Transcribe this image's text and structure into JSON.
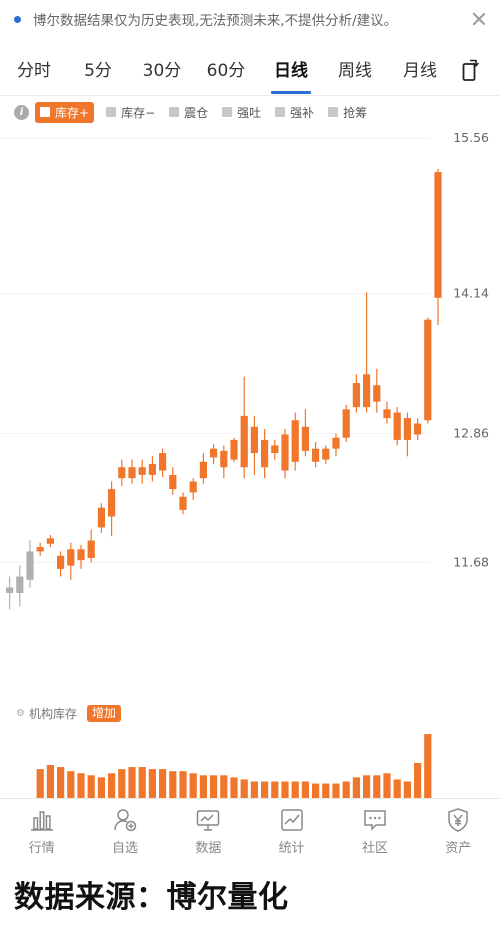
{
  "notice": {
    "text": "博尔数据结果仅为历史表现,无法预测未来,不提供分析/建议。"
  },
  "tabs": [
    "分时",
    "5分",
    "30分",
    "60分",
    "日线",
    "周线",
    "月线"
  ],
  "active_tab": "日线",
  "legend": {
    "items": [
      "库存+",
      "库存−",
      "震仓",
      "强吐",
      "强补",
      "抢筹"
    ],
    "active": "库存+"
  },
  "volume_panel": {
    "label": "机构库存",
    "badge": "增加"
  },
  "bottom_nav": [
    {
      "label": "行情",
      "icon": "bar-chart-icon"
    },
    {
      "label": "自选",
      "icon": "user-add-icon"
    },
    {
      "label": "数据",
      "icon": "monitor-chart-icon"
    },
    {
      "label": "统计",
      "icon": "line-chart-icon"
    },
    {
      "label": "社区",
      "icon": "chat-bubble-icon"
    },
    {
      "label": "资产",
      "icon": "yen-shield-icon"
    }
  ],
  "caption": "数据来源：博尔量化",
  "colors": {
    "up": "#f0762b",
    "down": "#b0b0b0",
    "accent": "#2a6fd6",
    "grid": "#f2f2f2"
  },
  "chart_data": {
    "type": "candlestick",
    "y_ticks": [
      "15.56",
      "14.14",
      "12.86",
      "11.68"
    ],
    "ylim": [
      11.0,
      15.6
    ],
    "candles": [
      {
        "o": 11.4,
        "c": 11.45,
        "h": 11.55,
        "l": 11.25,
        "color": "down"
      },
      {
        "o": 11.4,
        "c": 11.55,
        "h": 11.65,
        "l": 11.28,
        "color": "down"
      },
      {
        "o": 11.52,
        "c": 11.78,
        "h": 11.88,
        "l": 11.45,
        "color": "down"
      },
      {
        "o": 11.78,
        "c": 11.82,
        "h": 11.86,
        "l": 11.74,
        "color": "up"
      },
      {
        "o": 11.85,
        "c": 11.9,
        "h": 11.93,
        "l": 11.82,
        "color": "up"
      },
      {
        "o": 11.62,
        "c": 11.74,
        "h": 11.78,
        "l": 11.55,
        "color": "up"
      },
      {
        "o": 11.65,
        "c": 11.8,
        "h": 11.86,
        "l": 11.52,
        "color": "up"
      },
      {
        "o": 11.7,
        "c": 11.8,
        "h": 11.84,
        "l": 11.62,
        "color": "up"
      },
      {
        "o": 11.72,
        "c": 11.88,
        "h": 11.98,
        "l": 11.68,
        "color": "up"
      },
      {
        "o": 12.0,
        "c": 12.18,
        "h": 12.22,
        "l": 11.95,
        "color": "up"
      },
      {
        "o": 12.1,
        "c": 12.35,
        "h": 12.42,
        "l": 11.92,
        "color": "up"
      },
      {
        "o": 12.45,
        "c": 12.55,
        "h": 12.62,
        "l": 12.38,
        "color": "up"
      },
      {
        "o": 12.45,
        "c": 12.55,
        "h": 12.62,
        "l": 12.4,
        "color": "up"
      },
      {
        "o": 12.48,
        "c": 12.55,
        "h": 12.62,
        "l": 12.4,
        "color": "up"
      },
      {
        "o": 12.48,
        "c": 12.58,
        "h": 12.65,
        "l": 12.42,
        "color": "up"
      },
      {
        "o": 12.52,
        "c": 12.68,
        "h": 12.72,
        "l": 12.46,
        "color": "up"
      },
      {
        "o": 12.35,
        "c": 12.48,
        "h": 12.55,
        "l": 12.3,
        "color": "up"
      },
      {
        "o": 12.16,
        "c": 12.28,
        "h": 12.32,
        "l": 12.12,
        "color": "up"
      },
      {
        "o": 12.32,
        "c": 12.42,
        "h": 12.45,
        "l": 12.25,
        "color": "up"
      },
      {
        "o": 12.45,
        "c": 12.6,
        "h": 12.68,
        "l": 12.4,
        "color": "up"
      },
      {
        "o": 12.64,
        "c": 12.72,
        "h": 12.76,
        "l": 12.58,
        "color": "up"
      },
      {
        "o": 12.55,
        "c": 12.7,
        "h": 12.75,
        "l": 12.45,
        "color": "up"
      },
      {
        "o": 12.62,
        "c": 12.8,
        "h": 12.82,
        "l": 12.6,
        "color": "up"
      },
      {
        "o": 12.55,
        "c": 13.02,
        "h": 13.38,
        "l": 12.45,
        "color": "up"
      },
      {
        "o": 12.68,
        "c": 12.92,
        "h": 13.02,
        "l": 12.48,
        "color": "up"
      },
      {
        "o": 12.55,
        "c": 12.8,
        "h": 12.9,
        "l": 12.45,
        "color": "up"
      },
      {
        "o": 12.68,
        "c": 12.75,
        "h": 12.8,
        "l": 12.62,
        "color": "up"
      },
      {
        "o": 12.52,
        "c": 12.85,
        "h": 12.9,
        "l": 12.45,
        "color": "up"
      },
      {
        "o": 12.6,
        "c": 12.98,
        "h": 13.05,
        "l": 12.52,
        "color": "up"
      },
      {
        "o": 12.7,
        "c": 12.92,
        "h": 13.08,
        "l": 12.65,
        "color": "up"
      },
      {
        "o": 12.6,
        "c": 12.72,
        "h": 12.78,
        "l": 12.55,
        "color": "up"
      },
      {
        "o": 12.62,
        "c": 12.72,
        "h": 12.75,
        "l": 12.58,
        "color": "up"
      },
      {
        "o": 12.72,
        "c": 12.82,
        "h": 12.86,
        "l": 12.65,
        "color": "up"
      },
      {
        "o": 12.82,
        "c": 13.08,
        "h": 13.12,
        "l": 12.78,
        "color": "up"
      },
      {
        "o": 13.1,
        "c": 13.32,
        "h": 13.4,
        "l": 13.05,
        "color": "up"
      },
      {
        "o": 13.1,
        "c": 13.4,
        "h": 14.15,
        "l": 13.05,
        "color": "up"
      },
      {
        "o": 13.15,
        "c": 13.3,
        "h": 13.45,
        "l": 13.05,
        "color": "up"
      },
      {
        "o": 13.0,
        "c": 13.08,
        "h": 13.15,
        "l": 12.95,
        "color": "up"
      },
      {
        "o": 12.8,
        "c": 13.05,
        "h": 13.1,
        "l": 12.75,
        "color": "up"
      },
      {
        "o": 12.8,
        "c": 13.0,
        "h": 13.05,
        "l": 12.65,
        "color": "up"
      },
      {
        "o": 12.85,
        "c": 12.95,
        "h": 13.0,
        "l": 12.8,
        "color": "up"
      },
      {
        "o": 12.98,
        "c": 13.9,
        "h": 13.92,
        "l": 12.95,
        "color": "up"
      },
      {
        "o": 14.1,
        "c": 15.25,
        "h": 15.28,
        "l": 13.85,
        "color": "up"
      }
    ],
    "volume": [
      0,
      0,
      0,
      28,
      32,
      30,
      26,
      24,
      22,
      20,
      24,
      28,
      30,
      30,
      28,
      28,
      26,
      26,
      24,
      22,
      22,
      22,
      20,
      18,
      16,
      16,
      16,
      16,
      16,
      16,
      14,
      14,
      14,
      16,
      20,
      22,
      22,
      24,
      18,
      16,
      34,
      62
    ]
  }
}
